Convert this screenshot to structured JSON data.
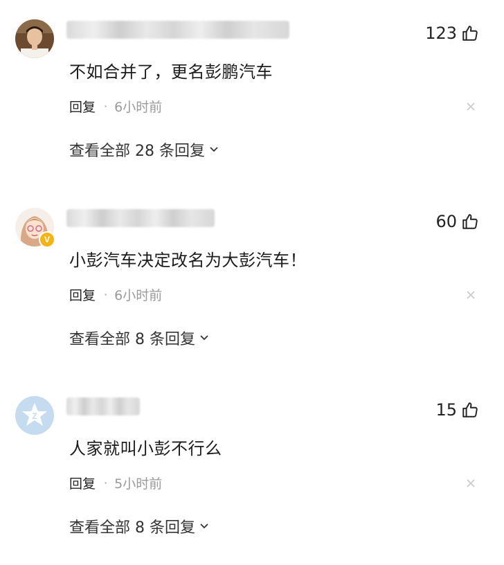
{
  "comments": [
    {
      "avatar": "portrait-photo-icon",
      "likes": "123",
      "text": "不如合并了，更名彭鹏汽车",
      "reply_label": "回复",
      "dot": "·",
      "time": "6小时前",
      "view_replies": "查看全部 28 条回复"
    },
    {
      "avatar": "cartoon-girl-icon",
      "verified_badge": "V",
      "likes": "60",
      "text": "小彭汽车决定改名为大彭汽车！",
      "reply_label": "回复",
      "dot": "·",
      "time": "6小时前",
      "view_replies": "查看全部 8 条回复"
    },
    {
      "avatar": "default-star-avatar-icon",
      "likes": "15",
      "text": "人家就叫小彭不行么",
      "reply_label": "回复",
      "dot": "·",
      "time": "5小时前",
      "view_replies": "查看全部 8 条回复"
    }
  ],
  "colors": {
    "text": "#1b1b1b",
    "meta_gray": "#9a9a9a",
    "close_gray": "#c8c8c8",
    "verified_gold": "#f2b416"
  }
}
